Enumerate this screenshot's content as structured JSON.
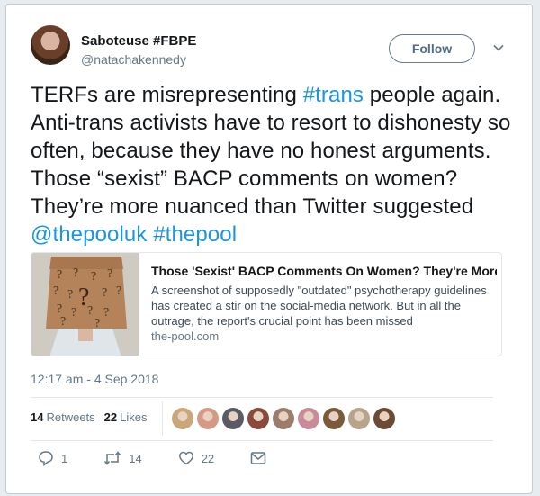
{
  "tweet": {
    "display_name": "Saboteuse #FBPE",
    "handle": "@natachakennedy",
    "follow_label": "Follow",
    "text_parts": [
      {
        "text": "TERFs are misrepresenting ",
        "link": false
      },
      {
        "text": "#trans",
        "link": true
      },
      {
        "text": " people again. Anti-trans activists have to resort to dishonesty so often, because they have no honest arguments. Those “sexist” BACP comments on women? They’re more nuanced than Twitter suggested ",
        "link": false
      },
      {
        "text": "@thepooluk",
        "link": true
      },
      {
        "text": " ",
        "link": false
      },
      {
        "text": "#thepool",
        "link": true
      }
    ],
    "timestamp": "12:17 am - 4 Sep 2018"
  },
  "card": {
    "title": "Those 'Sexist' BACP Comments On Women? They're More ...",
    "description": "A screenshot of supposedly \"outdated\" psychotherapy guidelines has created a stir on the social-media network. But in all the outrage, the report's crucial point has been missed",
    "domain": "the-pool.com"
  },
  "stats": {
    "retweets_count": "14",
    "retweets_label": "Retweets",
    "likes_count": "22",
    "likes_label": "Likes"
  },
  "likers": [
    "#caa77a",
    "#d59a86",
    "#5b5b66",
    "#8b4a3c",
    "#9a7d6a",
    "#c98a9a",
    "#7a5a3a",
    "#b7a48a",
    "#6b4b34"
  ],
  "actions": {
    "reply_count": "1",
    "retweet_count": "14",
    "like_count": "22"
  },
  "colors": {
    "link": "#1b95e0",
    "secondary_text": "#657786"
  },
  "icons": [
    "chevron-down-icon",
    "reply-icon",
    "retweet-icon",
    "heart-icon",
    "message-icon"
  ]
}
